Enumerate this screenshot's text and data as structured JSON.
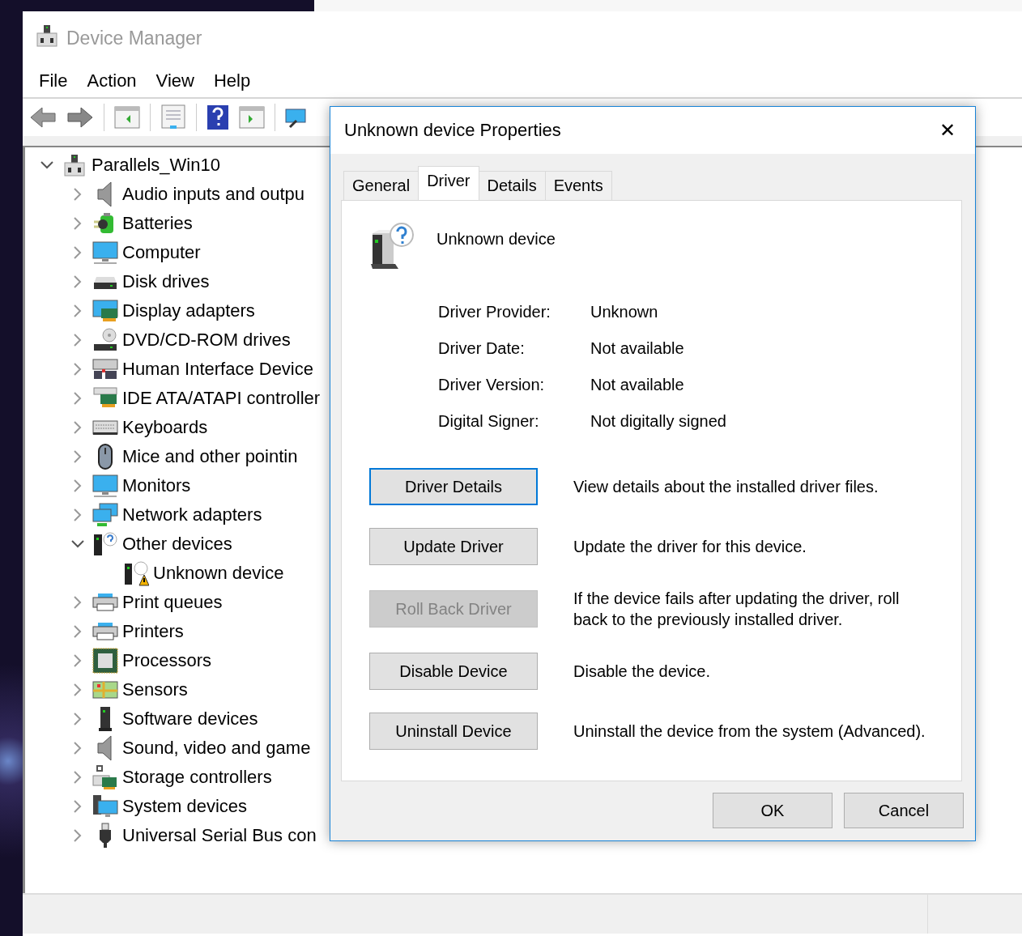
{
  "main_window": {
    "title": "Device Manager",
    "menu": [
      "File",
      "Action",
      "View",
      "Help"
    ],
    "tree": {
      "label": "Parallels_Win10",
      "expanded": true,
      "children": [
        {
          "label": "Audio inputs and outpu",
          "expanded": false
        },
        {
          "label": "Batteries",
          "expanded": false
        },
        {
          "label": "Computer",
          "expanded": false
        },
        {
          "label": "Disk drives",
          "expanded": false
        },
        {
          "label": "Display adapters",
          "expanded": false
        },
        {
          "label": "DVD/CD-ROM drives",
          "expanded": false
        },
        {
          "label": "Human Interface Device",
          "expanded": false
        },
        {
          "label": "IDE ATA/ATAPI controller",
          "expanded": false
        },
        {
          "label": "Keyboards",
          "expanded": false
        },
        {
          "label": "Mice and other pointin",
          "expanded": false
        },
        {
          "label": "Monitors",
          "expanded": false
        },
        {
          "label": "Network adapters",
          "expanded": false
        },
        {
          "label": "Other devices",
          "expanded": true,
          "children": [
            {
              "label": "Unknown device"
            }
          ]
        },
        {
          "label": "Print queues",
          "expanded": false
        },
        {
          "label": "Printers",
          "expanded": false
        },
        {
          "label": "Processors",
          "expanded": false
        },
        {
          "label": "Sensors",
          "expanded": false
        },
        {
          "label": "Software devices",
          "expanded": false
        },
        {
          "label": "Sound, video and game",
          "expanded": false
        },
        {
          "label": "Storage controllers",
          "expanded": false
        },
        {
          "label": "System devices",
          "expanded": false
        },
        {
          "label": "Universal Serial Bus con",
          "expanded": false
        }
      ]
    }
  },
  "dialog": {
    "title": "Unknown device Properties",
    "close": "✕",
    "tabs": [
      {
        "label": "General",
        "selected": false
      },
      {
        "label": "Driver",
        "selected": true
      },
      {
        "label": "Details",
        "selected": false
      },
      {
        "label": "Events",
        "selected": false
      }
    ],
    "device_name": "Unknown device",
    "fields": [
      {
        "label": "Driver Provider:",
        "value": "Unknown"
      },
      {
        "label": "Driver Date:",
        "value": "Not available"
      },
      {
        "label": "Driver Version:",
        "value": "Not available"
      },
      {
        "label": "Digital Signer:",
        "value": "Not digitally signed"
      }
    ],
    "actions": [
      {
        "button": "Driver Details",
        "description": "View details about the installed driver files.",
        "disabled": false,
        "focused": true
      },
      {
        "button": "Update Driver",
        "description": "Update the driver for this device.",
        "disabled": false,
        "focused": false
      },
      {
        "button": "Roll Back Driver",
        "description": "If the device fails after updating the driver, roll back to the previously installed driver.",
        "disabled": true,
        "focused": false
      },
      {
        "button": "Disable Device",
        "description": "Disable the device.",
        "disabled": false,
        "focused": false
      },
      {
        "button": "Uninstall Device",
        "description": "Uninstall the device from the system (Advanced).",
        "disabled": false,
        "focused": false
      }
    ],
    "footer_buttons": [
      "OK",
      "Cancel"
    ]
  }
}
